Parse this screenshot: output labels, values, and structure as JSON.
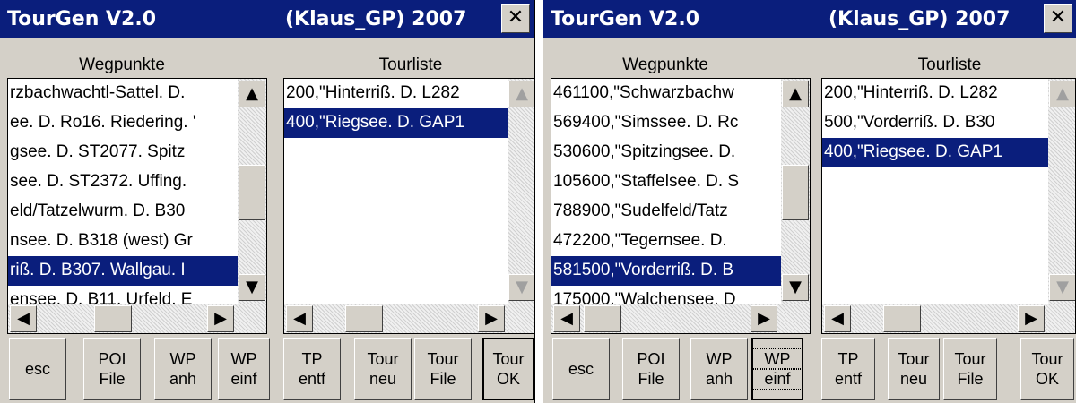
{
  "windows": [
    {
      "title_left": "TourGen V2.0",
      "title_right": "(Klaus_GP) 2007",
      "close_label": "✕",
      "wegpunkte_header": "Wegpunkte",
      "tourliste_header": "Tourliste",
      "wegpunkte_items": [
        "rzbachwachtl-Sattel. D.",
        "ee. D. Ro16. Riedering. '",
        "gsee. D. ST2077. Spitz",
        "see. D. ST2372. Uffing.",
        "eld/Tatzelwurm. D. B30",
        "nsee. D. B318 (west) Gr",
        "riß. D. B307. Wallgau. I",
        "ensee. D. B11. Urfeld. E"
      ],
      "wegpunkte_selected_index": 6,
      "tourliste_items": [
        "200,\"Hinterriß. D. L282",
        "400,\"Riegsee. D. GAP1"
      ],
      "tourliste_selected_index": 1,
      "buttons": [
        {
          "line1": "esc",
          "line2": ""
        },
        {
          "line1": "POI",
          "line2": "File"
        },
        {
          "line1": "WP",
          "line2": "anh"
        },
        {
          "line1": "WP",
          "line2": "einf"
        },
        {
          "line1": "TP",
          "line2": "entf"
        },
        {
          "line1": "Tour",
          "line2": "neu"
        },
        {
          "line1": "Tour",
          "line2": "File"
        },
        {
          "line1": "Tour",
          "line2": "OK"
        }
      ]
    },
    {
      "title_left": "TourGen V2.0",
      "title_right": "(Klaus_GP) 2007",
      "close_label": "✕",
      "wegpunkte_header": "Wegpunkte",
      "tourliste_header": "Tourliste",
      "wegpunkte_items": [
        "461100,\"Schwarzbachw",
        "569400,\"Simssee. D. Rc",
        "530600,\"Spitzingsee. D.",
        "105600,\"Staffelsee. D. S",
        "788900,\"Sudelfeld/Tatz",
        "472200,\"Tegernsee. D.",
        "581500,\"Vorderriß. D. B",
        "175000,\"Walchensee. D"
      ],
      "wegpunkte_selected_index": 6,
      "tourliste_items": [
        "200,\"Hinterriß. D. L282",
        "500,\"Vorderriß. D. B30",
        "400,\"Riegsee. D. GAP1"
      ],
      "tourliste_selected_index": 2,
      "buttons": [
        {
          "line1": "esc",
          "line2": ""
        },
        {
          "line1": "POI",
          "line2": "File"
        },
        {
          "line1": "WP",
          "line2": "anh"
        },
        {
          "line1": "WP",
          "line2": "einf"
        },
        {
          "line1": "TP",
          "line2": "entf"
        },
        {
          "line1": "Tour",
          "line2": "neu"
        },
        {
          "line1": "Tour",
          "line2": "File"
        },
        {
          "line1": "Tour",
          "line2": "OK"
        }
      ]
    }
  ],
  "scroll_arrows": {
    "up": "▲",
    "down": "▼",
    "left": "◀",
    "right": "▶"
  },
  "colors": {
    "titlebar": "#0a1e7c",
    "selection": "#0a1e7c",
    "face": "#d4d0c8"
  }
}
